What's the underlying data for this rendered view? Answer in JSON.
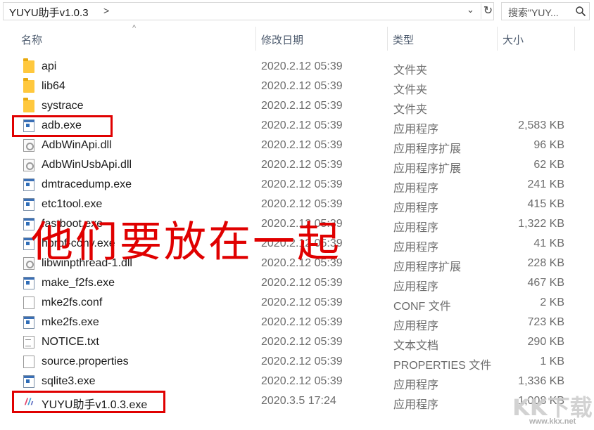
{
  "address_bar": {
    "path": "YUYU助手v1.0.3",
    "separator": ">",
    "dropdown_icon": "chevron-down-icon",
    "refresh_icon": "refresh-icon"
  },
  "search": {
    "placeholder": "搜索\"YUY..."
  },
  "columns": {
    "name": "名称",
    "modified": "修改日期",
    "type": "类型",
    "size": "大小",
    "sort_indicator": "^"
  },
  "files": [
    {
      "name": "api",
      "modified": "2020.2.12 05:39",
      "type": "文件夹",
      "size": "",
      "icon": "folder-icon"
    },
    {
      "name": "lib64",
      "modified": "2020.2.12 05:39",
      "type": "文件夹",
      "size": "",
      "icon": "folder-icon"
    },
    {
      "name": "systrace",
      "modified": "2020.2.12 05:39",
      "type": "文件夹",
      "size": "",
      "icon": "folder-icon"
    },
    {
      "name": "adb.exe",
      "modified": "2020.2.12 05:39",
      "type": "应用程序",
      "size": "2,583 KB",
      "icon": "exe-icon"
    },
    {
      "name": "AdbWinApi.dll",
      "modified": "2020.2.12 05:39",
      "type": "应用程序扩展",
      "size": "96 KB",
      "icon": "dll-icon"
    },
    {
      "name": "AdbWinUsbApi.dll",
      "modified": "2020.2.12 05:39",
      "type": "应用程序扩展",
      "size": "62 KB",
      "icon": "dll-icon"
    },
    {
      "name": "dmtracedump.exe",
      "modified": "2020.2.12 05:39",
      "type": "应用程序",
      "size": "241 KB",
      "icon": "exe-icon"
    },
    {
      "name": "etc1tool.exe",
      "modified": "2020.2.12 05:39",
      "type": "应用程序",
      "size": "415 KB",
      "icon": "exe-icon"
    },
    {
      "name": "fastboot.exe",
      "modified": "2020.2.12 05:39",
      "type": "应用程序",
      "size": "1,322 KB",
      "icon": "exe-icon"
    },
    {
      "name": "hprof-conv.exe",
      "modified": "2020.2.12 05:39",
      "type": "应用程序",
      "size": "41 KB",
      "icon": "exe-icon"
    },
    {
      "name": "libwinpthread-1.dll",
      "modified": "2020.2.12 05:39",
      "type": "应用程序扩展",
      "size": "228 KB",
      "icon": "dll-icon"
    },
    {
      "name": "make_f2fs.exe",
      "modified": "2020.2.12 05:39",
      "type": "应用程序",
      "size": "467 KB",
      "icon": "exe-icon"
    },
    {
      "name": "mke2fs.conf",
      "modified": "2020.2.12 05:39",
      "type": "CONF 文件",
      "size": "2 KB",
      "icon": "file-icon"
    },
    {
      "name": "mke2fs.exe",
      "modified": "2020.2.12 05:39",
      "type": "应用程序",
      "size": "723 KB",
      "icon": "exe-icon"
    },
    {
      "name": "NOTICE.txt",
      "modified": "2020.2.12 05:39",
      "type": "文本文档",
      "size": "290 KB",
      "icon": "text-file-icon"
    },
    {
      "name": "source.properties",
      "modified": "2020.2.12 05:39",
      "type": "PROPERTIES 文件",
      "size": "1 KB",
      "icon": "file-icon"
    },
    {
      "name": "sqlite3.exe",
      "modified": "2020.2.12 05:39",
      "type": "应用程序",
      "size": "1,336 KB",
      "icon": "exe-icon"
    },
    {
      "name": "YUYU助手v1.0.3.exe",
      "modified": "2020.3.5 17:24",
      "type": "应用程序",
      "size": "1,008 KB",
      "icon": "yuyu-app-icon"
    }
  ],
  "annotation": {
    "caption": "他们要放在一起",
    "highlight_color": "#e00000"
  },
  "watermark": {
    "logo_text": "KK下载",
    "url": "www.kkx.net"
  }
}
